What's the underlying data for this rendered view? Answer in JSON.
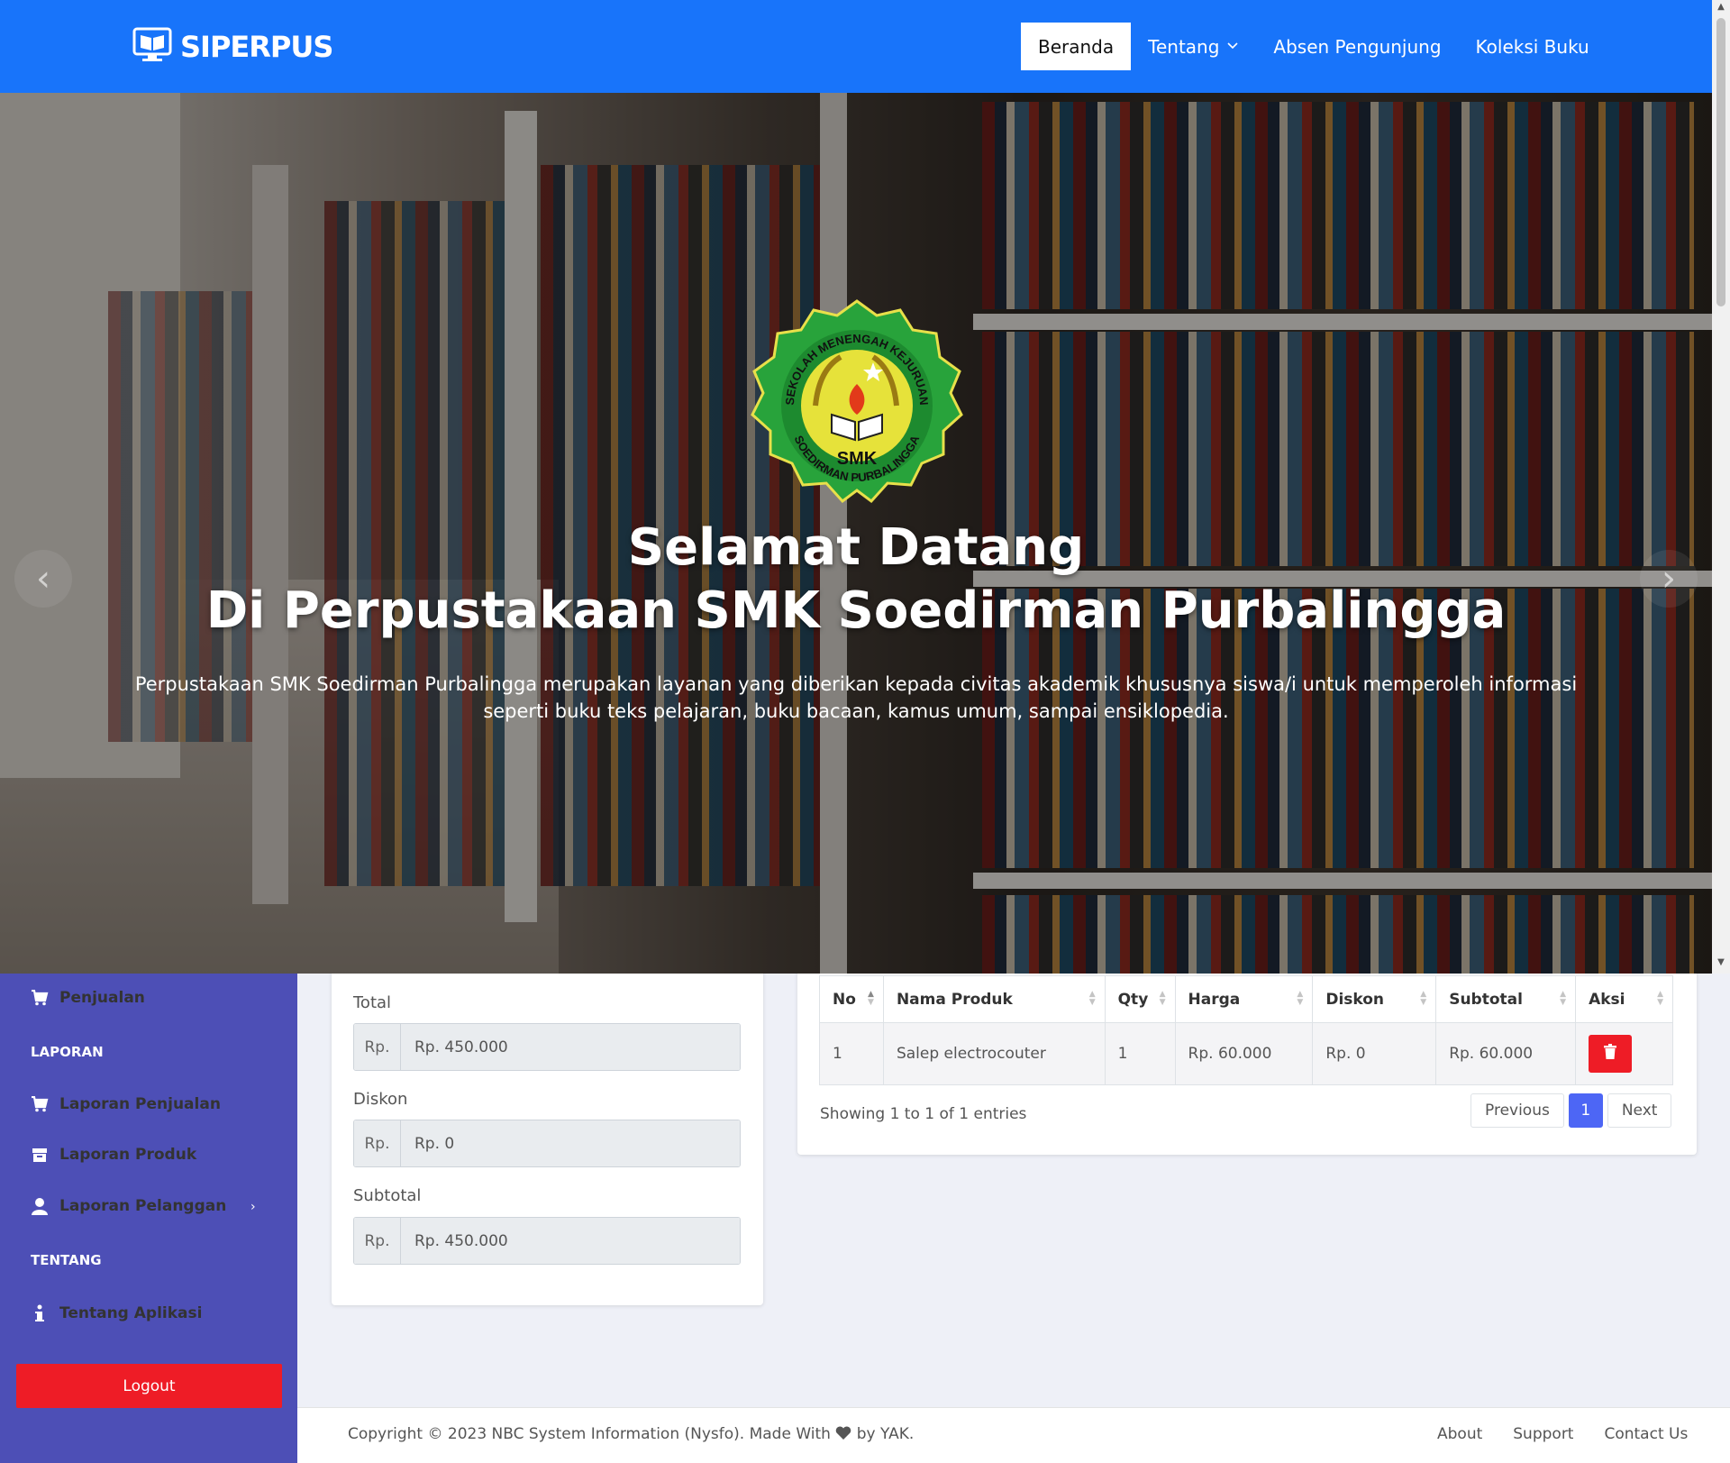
{
  "nav": {
    "brand": "SIPERPUS",
    "links": [
      {
        "label": "Beranda"
      },
      {
        "label": "Tentang"
      },
      {
        "label": "Absen Pengunjung"
      },
      {
        "label": "Koleksi Buku"
      }
    ]
  },
  "hero": {
    "logo_text": "SMK",
    "logo_ring_top": "SEKOLAH MENENGAH KEJURUAN",
    "logo_ring_bottom": "SOEDIRMAN PURBALINGGA",
    "title_line1": "Selamat Datang",
    "title_line2": "Di Perpustakaan SMK Soedirman Purbalingga",
    "description": "Perpustakaan SMK Soedirman Purbalingga merupakan layanan yang diberikan kepada civitas akademik khususnya siswa/i untuk memperoleh informasi seperti buku teks pelajaran, buku bacaan, kamus umum, sampai ensiklopedia."
  },
  "sidebar": {
    "items": [
      {
        "label": "Penjualan",
        "icon": "cart-icon"
      },
      {
        "label": "LAPORAN"
      },
      {
        "label": "Laporan Penjualan",
        "icon": "cart-icon"
      },
      {
        "label": "Laporan Produk",
        "icon": "box-icon"
      },
      {
        "label": "Laporan Pelanggan",
        "icon": "user-icon"
      },
      {
        "label": "TENTANG"
      },
      {
        "label": "Tentang Aplikasi",
        "icon": "info-icon"
      }
    ],
    "logout": "Logout"
  },
  "form": {
    "total_label": "Total",
    "total_prefix": "Rp.",
    "total_value": "Rp. 450.000",
    "diskon_label": "Diskon",
    "diskon_prefix": "Rp.",
    "diskon_value": "Rp. 0",
    "subtotal_label": "Subtotal",
    "subtotal_prefix": "Rp.",
    "subtotal_value": "Rp. 450.000"
  },
  "table": {
    "headers": [
      "No",
      "Nama Produk",
      "Qty",
      "Harga",
      "Diskon",
      "Subtotal",
      "Aksi"
    ],
    "rows": [
      [
        "1",
        "Salep electrocouter",
        "1",
        "Rp. 60.000",
        "Rp. 0",
        "Rp. 60.000"
      ]
    ],
    "showing": "Showing 1 to 1 of 1 entries",
    "prev": "Previous",
    "page": "1",
    "next": "Next"
  },
  "footer": {
    "copyright_pre": "Copyright © 2023 NBC System Information (Nysfo). Made With",
    "copyright_post": "by YAK.",
    "links": [
      "About",
      "Support",
      "Contact Us"
    ]
  },
  "colors": {
    "nav_bg": "#1874fa",
    "sidebar_bg": "#4d4fb6",
    "logout": "#ee1c26",
    "page_active": "#4d66f5"
  }
}
